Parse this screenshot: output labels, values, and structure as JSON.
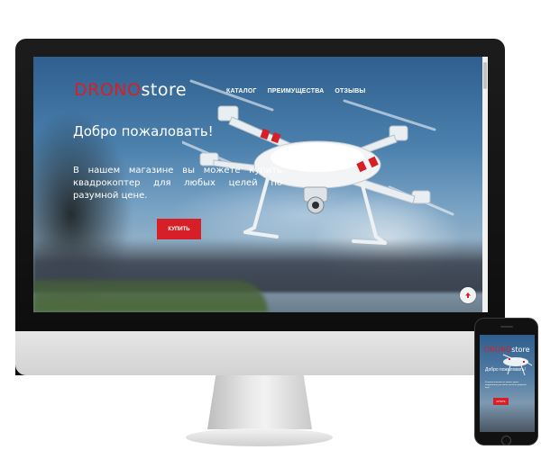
{
  "site": {
    "logo_part1": "DRONO",
    "logo_part2": "store",
    "nav": [
      "КАТАЛОГ",
      "ПРЕИМУЩЕСТВА",
      "ОТЗЫВЫ"
    ],
    "welcome": "Добро пожаловать!",
    "lead": "В нашем магазине вы можете купить квадрокоптер для любых целей по разумной цене.",
    "buy_label": "КУПИТЬ",
    "scroll_top_icon": "arrow-up-icon"
  },
  "colors": {
    "accent": "#d61f26",
    "text": "#ffffff",
    "monitor_bezel": "#111111",
    "monitor_chin": "#dcdcdc"
  }
}
